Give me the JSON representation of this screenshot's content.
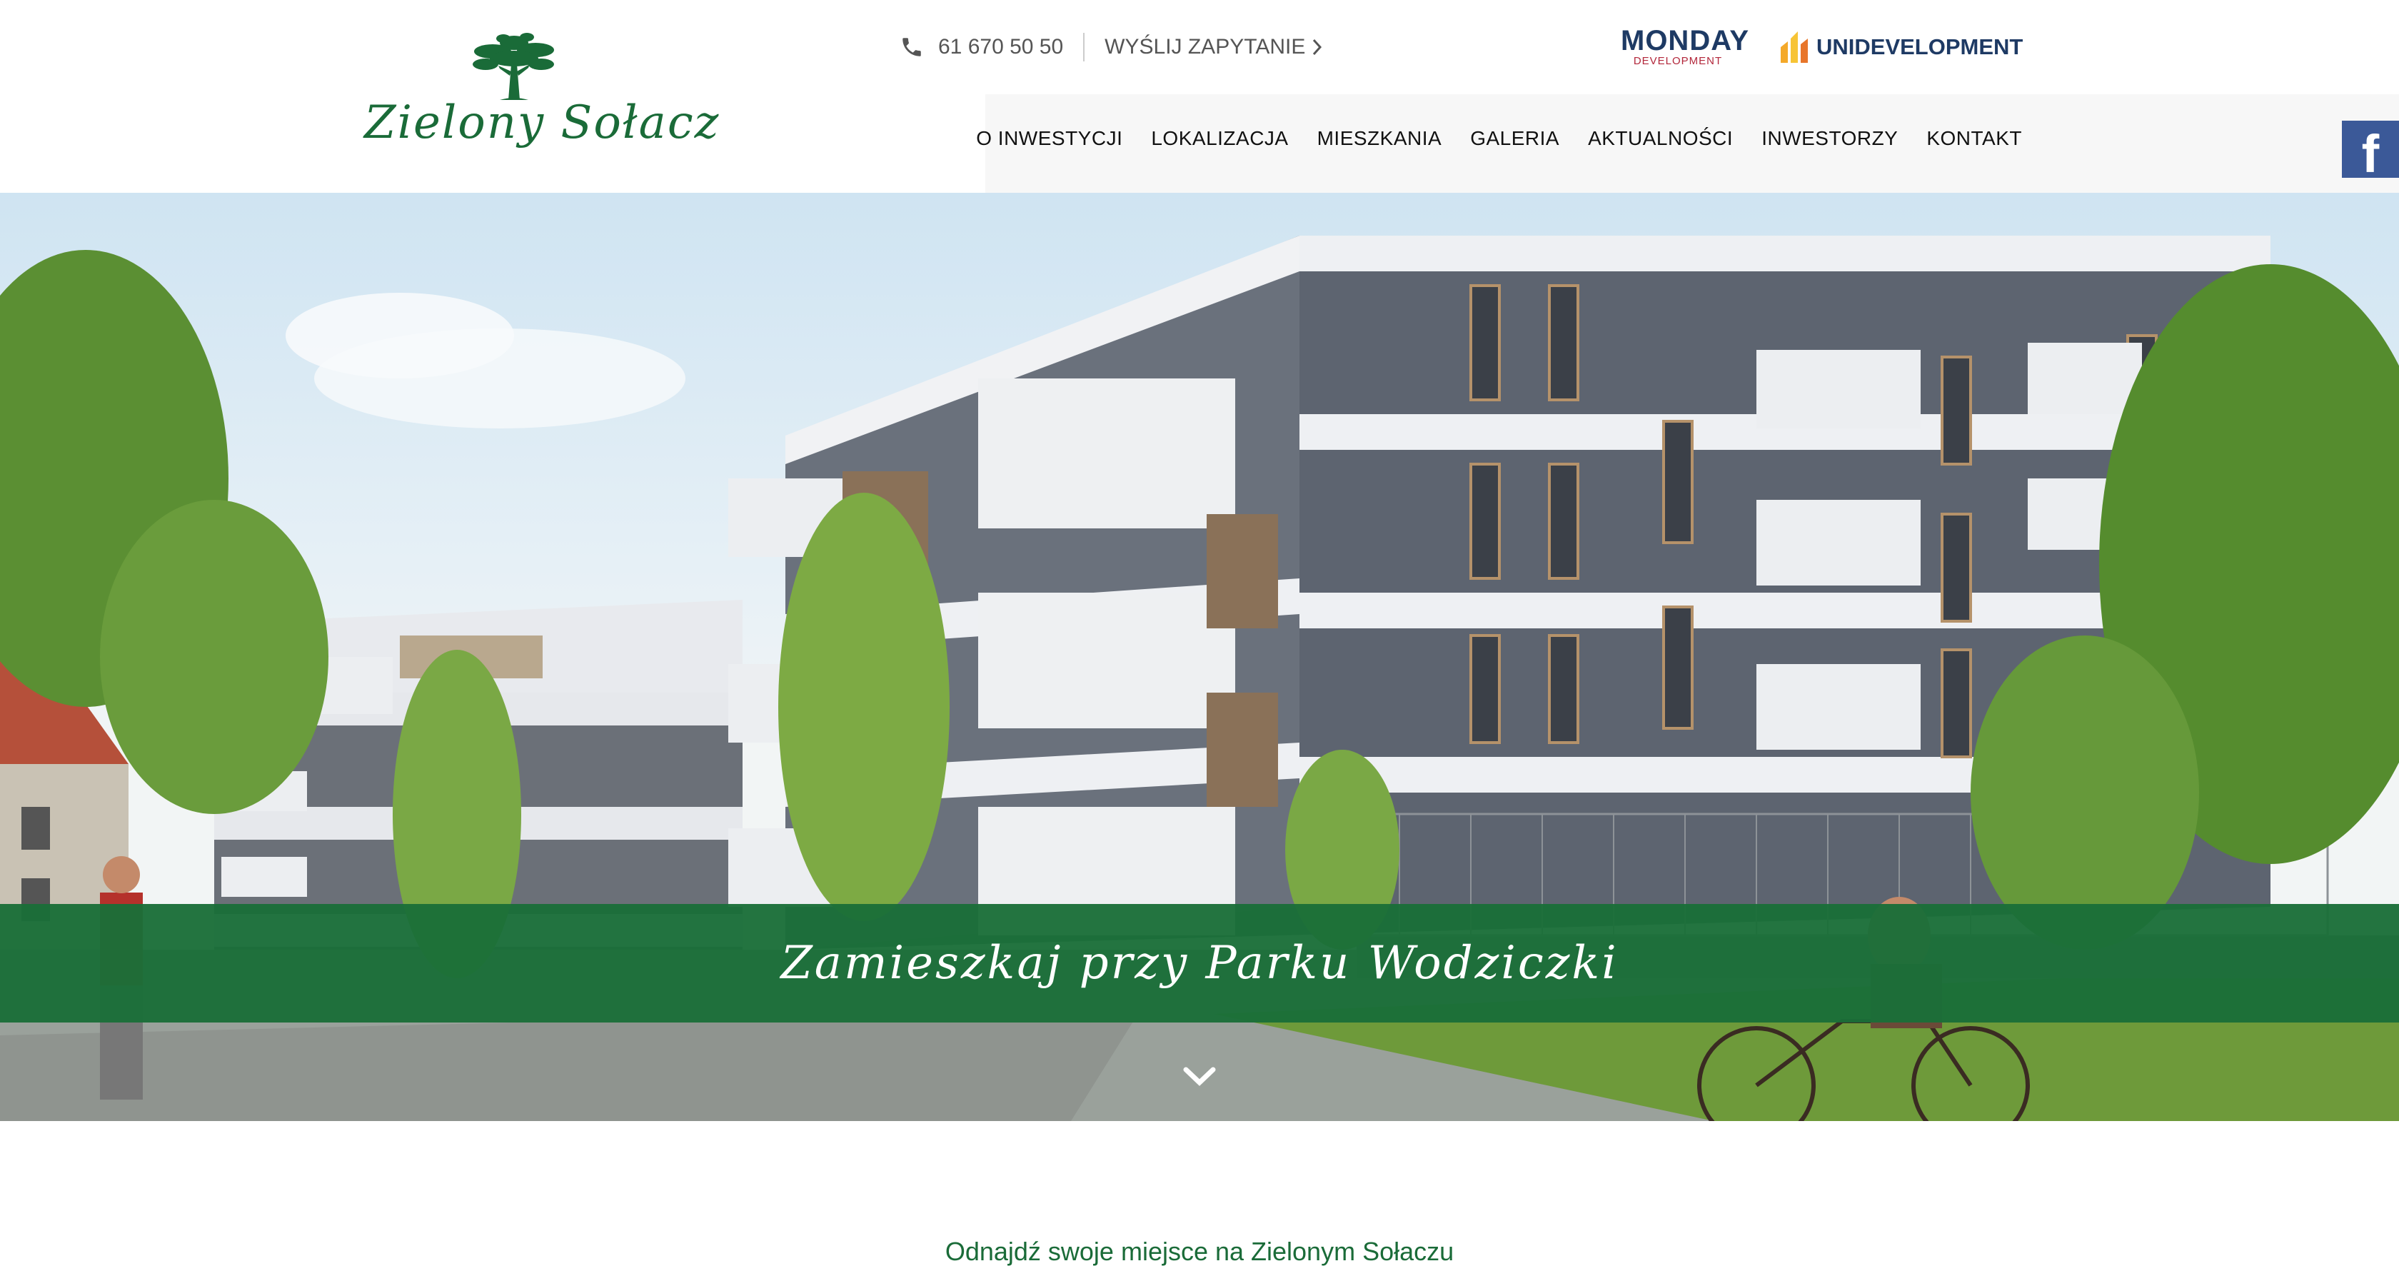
{
  "header": {
    "logo_text": "Zielony Sołacz",
    "phone": "61 670 50 50",
    "inquiry_label": "WYŚLIJ ZAPYTANIE",
    "partners": {
      "monday_name": "MONDAY",
      "monday_sub": "DEVELOPMENT",
      "uni_name": "UNIDEVELOPMENT"
    }
  },
  "nav": {
    "items": [
      {
        "label": "O INWESTYCJI"
      },
      {
        "label": "LOKALIZACJA"
      },
      {
        "label": "MIESZKANIA"
      },
      {
        "label": "GALERIA"
      },
      {
        "label": "AKTUALNOŚCI"
      },
      {
        "label": "INWESTORZY"
      },
      {
        "label": "KONTAKT"
      }
    ]
  },
  "social": {
    "facebook_glyph": "f"
  },
  "hero": {
    "tagline": "Zamieszkaj przy Parku Wodziczki"
  },
  "section": {
    "subheading": "Odnajdź swoje miejsce na Zielonym Sołaczu"
  },
  "colors": {
    "brand_green": "#1a6e38",
    "facebook": "#3b5998",
    "monday_navy": "#1e3a64",
    "monday_red": "#b2263a"
  },
  "icons": [
    "tree-logo-icon",
    "phone-icon",
    "chevron-right-icon",
    "unidevelopment-logo-icon",
    "facebook-icon",
    "chevron-down-icon"
  ]
}
